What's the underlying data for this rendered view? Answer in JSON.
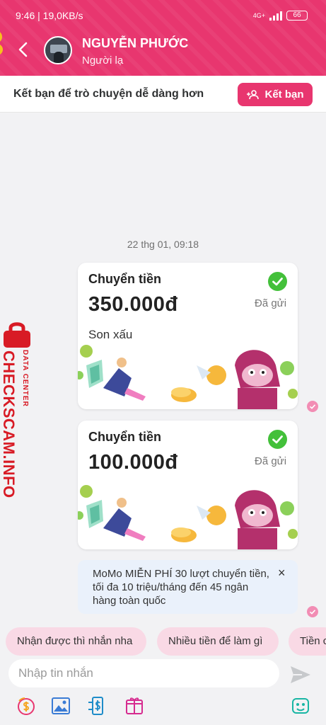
{
  "status_bar": {
    "time_speed": "9:46 | 19,0KB/s",
    "network": "4G+",
    "battery": "66"
  },
  "header": {
    "contact_name": "NGUYỄN PHƯỚC",
    "contact_relation": "Người lạ"
  },
  "friend_banner": {
    "text": "Kết bạn để trò chuyện dễ dàng hơn",
    "button_label": "Kết bạn"
  },
  "chat": {
    "timestamp": "22 thg 01, 09:18",
    "transfers": [
      {
        "title": "Chuyển tiền",
        "amount": "350.000đ",
        "status": "Đã gửi",
        "note": "Son xấu"
      },
      {
        "title": "Chuyển tiền",
        "amount": "100.000đ",
        "status": "Đã gửi"
      }
    ],
    "promo": {
      "text": "MoMo MIỄN PHÍ 30 lượt chuyển tiền, tối đa 10 triệu/tháng đến 45 ngân hàng toàn quốc",
      "close_label": "×"
    }
  },
  "watermark": {
    "main": "CHECKSCAM.INFO",
    "sub": "DATA CENTER"
  },
  "quick_replies": [
    "Nhận được thì nhắn nha",
    "Nhiều tiền để làm gì",
    "Tiền c"
  ],
  "composer": {
    "placeholder": "Nhập tin nhắn"
  },
  "toolbar": {
    "icons": [
      "money-transfer-icon",
      "image-icon",
      "bank-transfer-icon",
      "gift-envelope-icon",
      "sticker-icon"
    ]
  },
  "colors": {
    "brand": "#e8366f",
    "check": "#43c03a",
    "chip": "#f9d9e5",
    "promo_bg": "#eaf1fb",
    "watermark": "#d81b25"
  }
}
